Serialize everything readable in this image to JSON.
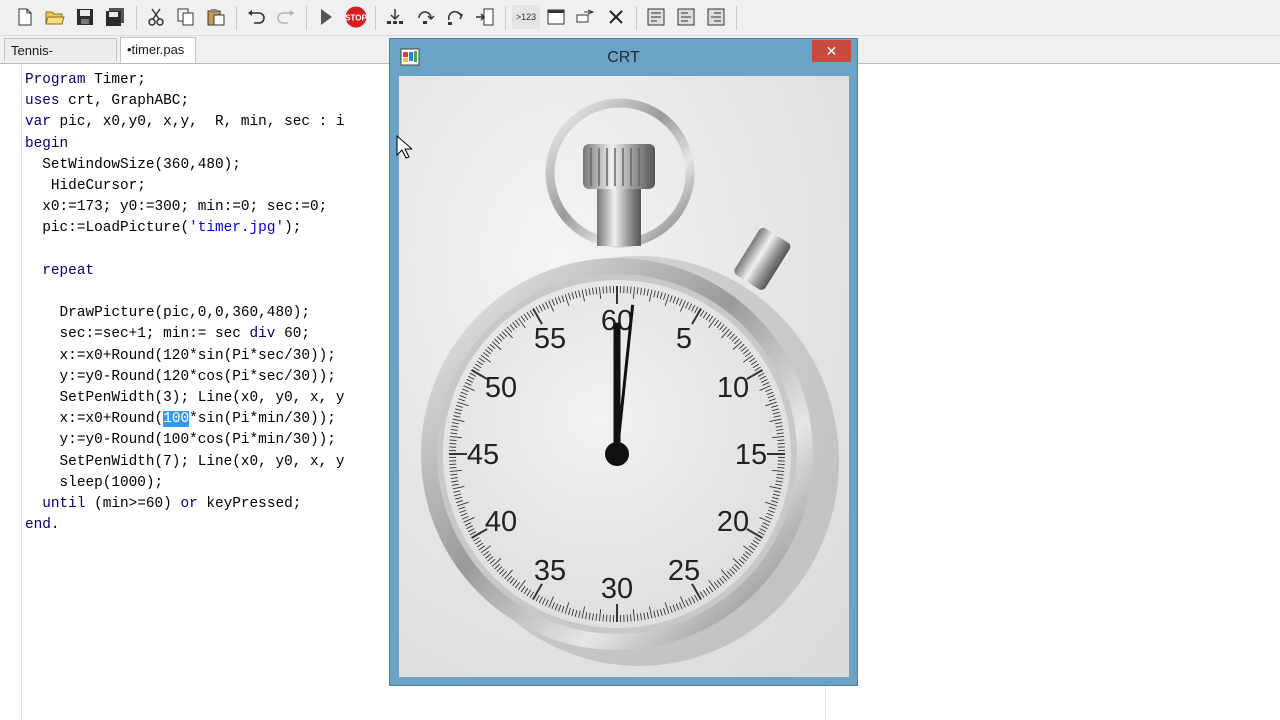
{
  "toolbar": {
    "buttons": [
      "new-file-icon",
      "open-folder-icon",
      "save-icon",
      "save-all-icon",
      "cut-icon",
      "copy-icon",
      "paste-icon",
      "undo-icon",
      "redo-icon",
      "run-icon",
      "stop-icon",
      "step-into-icon",
      "step-over-icon",
      "step-out-icon",
      "run-to-cursor-icon",
      "watch-icon",
      "output-window-icon",
      "breakpoint-icon",
      "close-icon",
      "format-icon",
      "align-left-icon",
      "align-right-icon"
    ],
    "stop_label": "STOP",
    "watch_label": ">123"
  },
  "tabs": [
    {
      "label": "Tennis-green.pas",
      "active": false
    },
    {
      "label": "•timer.pas",
      "active": true
    }
  ],
  "code": {
    "l1_kw": "Program",
    "l1_rest": " Timer;",
    "l2_kw": "uses",
    "l2_rest": " crt, GraphABC;",
    "l3_kw": "var",
    "l3_rest": " pic, x0,y0, x,y,  R, min, sec : i",
    "l4_kw": "begin",
    "l5": "  SetWindowSize(360,480);",
    "l6": "   HideCursor;",
    "l7": "  x0:=173; y0:=300; min:=0; sec:=0;",
    "l8_a": "  pic:=LoadPicture(",
    "l8_str": "'timer.jpg'",
    "l8_b": ");",
    "l9": "",
    "l10_kw": "  repeat",
    "l11": "",
    "l12": "    DrawPicture(pic,0,0,360,480);",
    "l13_a": "    sec:=sec+1; min:= sec ",
    "l13_kw": "div",
    "l13_b": " 60;",
    "l14": "    x:=x0+Round(120*sin(Pi*sec/30));",
    "l15": "    y:=y0-Round(120*cos(Pi*sec/30));",
    "l16": "    SetPenWidth(3); Line(x0, y0, x, y",
    "l17_a": "    x:=x0+Round(",
    "l17_sel": "100",
    "l17_b": "*sin(Pi*min/30));",
    "l18": "    y:=y0-Round(100*cos(Pi*min/30));",
    "l19": "    SetPenWidth(7); Line(x0, y0, x, y",
    "l20": "    sleep(1000);",
    "l21_kw": "  until",
    "l21_a": " (min>=60) ",
    "l21_kw2": "or",
    "l21_b": " keyPressed;",
    "l22_kw": "end",
    "l22_rest": "."
  },
  "crt": {
    "title": "CRT",
    "close_label": "✕",
    "dial_numbers": [
      "60",
      "5",
      "10",
      "15",
      "20",
      "25",
      "30",
      "35",
      "40",
      "45",
      "50",
      "55"
    ],
    "hands": {
      "seconds": 1,
      "minutes": 0
    }
  },
  "colors": {
    "keyword": "#00007a",
    "string": "#0000e0",
    "selection": "#3399ff",
    "crt_frame": "#6aa3c6",
    "close_button": "#c94a3f"
  }
}
